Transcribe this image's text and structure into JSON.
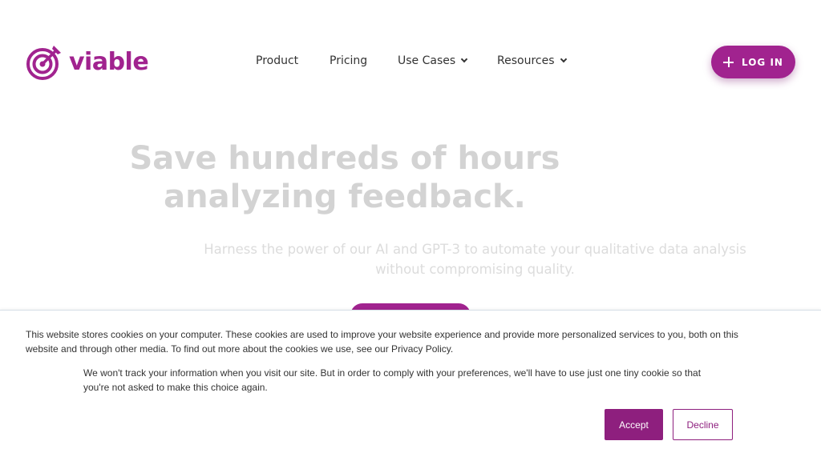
{
  "header": {
    "logo_text": "viable",
    "logo_icon": "target-arrow-icon",
    "nav": [
      {
        "label": "Product",
        "has_dropdown": false
      },
      {
        "label": "Pricing",
        "has_dropdown": false
      },
      {
        "label": "Use Cases",
        "has_dropdown": true
      },
      {
        "label": "Resources",
        "has_dropdown": true
      }
    ],
    "login_label": "LOG IN"
  },
  "hero": {
    "title_line1": "Save hundreds of hours",
    "title_line2": "analyzing feedback.",
    "subtitle_line1": "Harness the power of our AI and GPT-3 to automate your qualitative data analysis",
    "subtitle_line2": "without compromising quality."
  },
  "cookie_banner": {
    "text_line1": "This website stores cookies on your computer. These cookies are used to improve your website experience and provide more personalized services to you, both on this",
    "text_line2": "website and through other media. To find out more about the cookies we use, see our Privacy Policy.",
    "notice_line1": "We won't track your information when you visit our site. But in order to comply with your preferences, we'll have to use just one tiny cookie so that",
    "notice_line2": "you're not asked to make this choice again.",
    "accept_label": "Accept",
    "decline_label": "Decline"
  },
  "colors": {
    "brand": "#a1238f",
    "button_dark": "#8e1f7e",
    "hero_text": "#d3d3d3"
  }
}
